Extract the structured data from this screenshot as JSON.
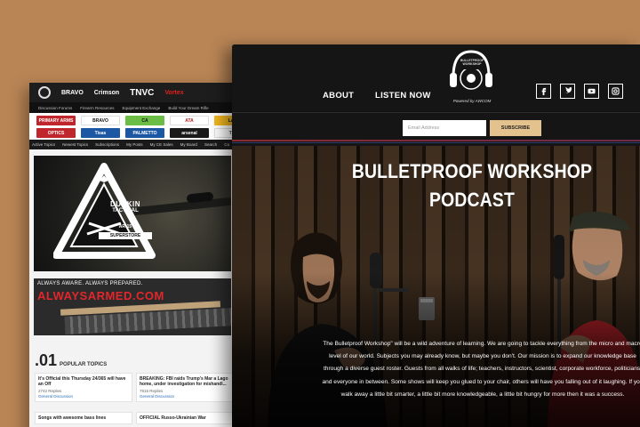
{
  "forum": {
    "top_logos": [
      "BRAVO",
      "Crimson",
      "TNVC",
      "Vortex"
    ],
    "menu": [
      "Discussion Forums",
      "Firearm Resources",
      "Equipment Exchange",
      "Build Your Dream Rifle"
    ],
    "sponsors": [
      {
        "name": "PRIMARY ARMS",
        "bg": "#c0272d",
        "fg": "#ffffff"
      },
      {
        "name": "BRAVO",
        "bg": "#ffffff",
        "fg": "#111111"
      },
      {
        "name": "CA",
        "bg": "#6bbd45",
        "fg": "#111111"
      },
      {
        "name": "ATA",
        "bg": "#ffffff",
        "fg": "#b51f24"
      },
      {
        "name": "LaRu",
        "bg": "#f3b81e",
        "fg": "#111111"
      },
      {
        "name": "OPTICS",
        "bg": "#c0272d",
        "fg": "#ffffff"
      },
      {
        "name": "Tisas",
        "bg": "#1b57a3",
        "fg": "#ffffff"
      },
      {
        "name": "PALMETTO",
        "bg": "#1b57a3",
        "fg": "#ffffff"
      },
      {
        "name": "arsenal",
        "bg": "#1a1a1a",
        "fg": "#ffffff"
      },
      {
        "name": "TRO",
        "bg": "#ffffff",
        "fg": "#444444"
      }
    ],
    "nav": [
      "Active Topics",
      "Newest Topics",
      "Subscriptions",
      "My Posts",
      "My CE Sales",
      "My Board",
      "Search",
      "Ca"
    ],
    "durkin": {
      "name": "DURKIN",
      "tag": "TACTICAL",
      "model": "AR-15",
      "store": "SUPERSTORE"
    },
    "armed": {
      "tagline": "ALWAYS AWARE. ALWAYS PREPARED.",
      "brand": "ALWAYSARMED.COM"
    },
    "popular": {
      "number": ".01",
      "label": "POPULAR TOPICS"
    },
    "topics": [
      {
        "title": "It's Official this Thursday 24/365 will have an Off",
        "replies": "2742 Replies",
        "category": "General Discussion"
      },
      {
        "title": "BREAKING: FBI raids Trump's Mar a Lago home, under investigation for mishandl...",
        "replies": "7815 Replies",
        "category": "General Discussion"
      },
      {
        "title": "Songs with awesome bass lines",
        "replies": "",
        "category": ""
      },
      {
        "title": "OFFICIAL Russo-Ukrainian War",
        "replies": "",
        "category": ""
      }
    ]
  },
  "podcast": {
    "nav": {
      "about": "ABOUT",
      "listen": "LISTEN NOW"
    },
    "logo": {
      "top": "BULLETPROOF",
      "bottom": "WORKSHOP",
      "powered": "Powered by AWCOM"
    },
    "social": [
      "facebook-icon",
      "twitter-icon",
      "youtube-icon",
      "instagram-icon"
    ],
    "subscribe": {
      "placeholder": "Email Address",
      "button": "SUBSCRIBE"
    },
    "title_line1": "BULLETPROOF WORKSHOP",
    "title_line2": "PODCAST",
    "description": "The Bulletproof Workshop\" will be a wild adventure of learning. We are going to tackle everything from the micro and macro level of our world. Subjects you may already know, but maybe you don't. Our mission is to expand our knowledge base through a diverse guest roster. Guests from all walks of life; teachers, instructors, scientist, corporate workforce, politicians, and everyone in between. Some shows will keep you glued to your chair, others will have you falling out of it laughing. If you walk away a little bit smarter, a little bit more knowledgeable, a little bit hungry for more then it was a success.",
    "colors": {
      "accent": "#e3c28e",
      "header_bg": "#151515"
    }
  }
}
